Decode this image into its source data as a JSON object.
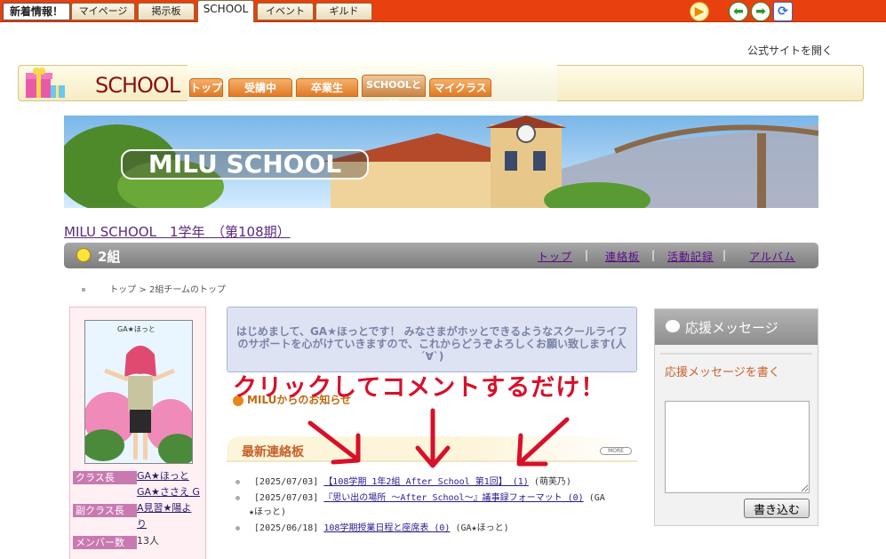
{
  "topbar": {
    "tabs": [
      "新着情報！",
      "マイページ",
      "掲示板",
      "SCHOOL",
      "イベント",
      "ギルド"
    ]
  },
  "official_link": "公式サイトを開く",
  "school_header": {
    "title": "SCHOOL",
    "tabs": [
      "トップ",
      "受講中",
      "卒業生",
      "SCHOOLとは",
      "マイクラス"
    ]
  },
  "banner": {
    "title": "MILU SCHOOL"
  },
  "school_link": "MILU SCHOOL　1学年　（第108期）",
  "classbar": {
    "name": "2組",
    "nav": [
      "トップ",
      "連絡板",
      "活動記録",
      "アルバム"
    ],
    "sep": "|"
  },
  "breadcrumb": {
    "home": "トップ",
    "arrow": ">",
    "current": "2組チームのトップ"
  },
  "profile": {
    "avatar_caption": "GA★ほっと",
    "leader_label": "クラス長",
    "leader_values": [
      "GA★ほっと",
      "GA★ささえ G"
    ],
    "vice_label": "副クラス長",
    "vice_values": [
      "A見習★陽よ",
      "り"
    ],
    "members_label": "メンバー数",
    "members_value": "13人"
  },
  "greeting": "はじめまして、GA★ほっとです！ みなさまがホッとできるようなスクールライフのサポートを心がけていきますので、これからどうぞよろしくお願い致します(人´∀`)",
  "overlay_text": "クリックしてコメントするだけ！",
  "notice": "MILUからのお知らせ",
  "board": {
    "title": "最新連絡板",
    "more": "MORE",
    "posts": [
      {
        "date": "[2025/07/03]",
        "title": "【108学期 1年2組 After School 第1回】 (1)",
        "author": "(萌芙乃)"
      },
      {
        "date": "[2025/07/03]",
        "title": "『思い出の場所 ～After School～』議事録フォーマット (0)",
        "author": "(GA"
      },
      {
        "author_cont": "★ほっと)"
      },
      {
        "date": "[2025/06/18]",
        "title": "108学期授業日程と座席表 (0)",
        "author": "(GA★ほっと)"
      }
    ]
  },
  "cheer": {
    "title": "応援メッセージ",
    "write_link": "応援メッセージを書く",
    "button": "書き込む"
  },
  "colors": {
    "topbar": "#e8400f",
    "arrow": "#d8102a",
    "link": "#5a2a7a",
    "accent_orange": "#c8602a"
  }
}
